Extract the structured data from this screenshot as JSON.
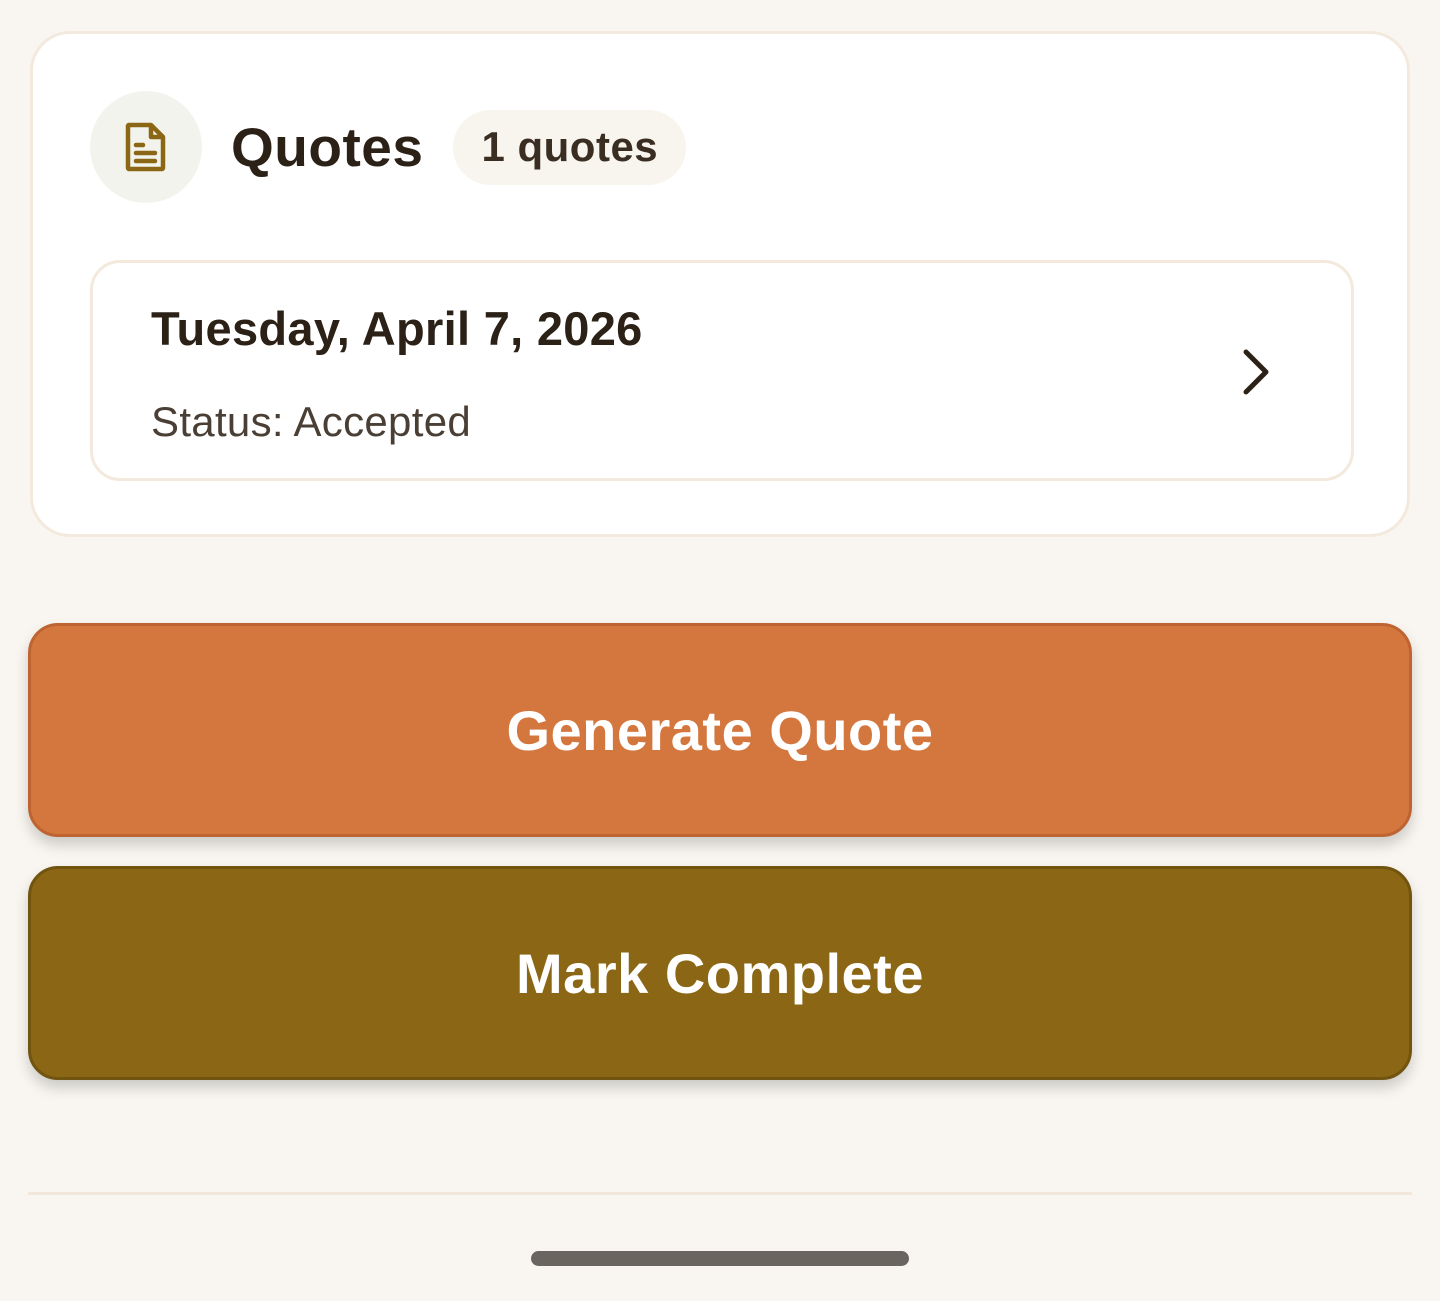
{
  "quotes_section": {
    "title": "Quotes",
    "count_label": "1 quotes",
    "icon": "document-icon",
    "items": [
      {
        "date": "Tuesday, April 7, 2026",
        "status": "Status: Accepted"
      }
    ]
  },
  "actions": {
    "generate_label": "Generate Quote",
    "complete_label": "Mark Complete"
  },
  "colors": {
    "background": "#f9f6f1",
    "generate_button": "#d4773e",
    "complete_button": "#8b6715",
    "icon_accent": "#8b6715",
    "text_primary": "#2b2116"
  }
}
